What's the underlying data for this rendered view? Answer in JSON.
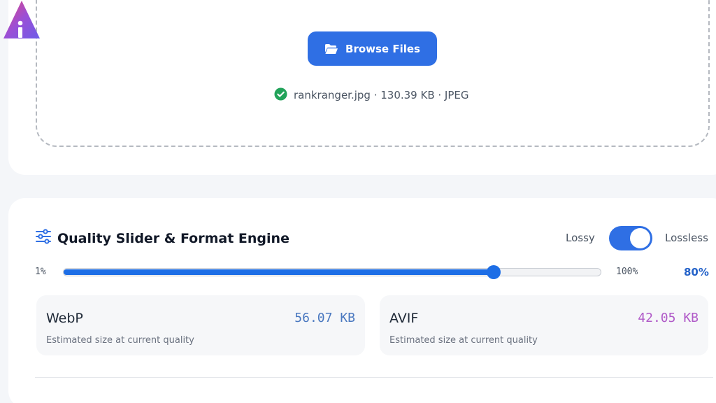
{
  "upload": {
    "browse_label": "Browse Files",
    "file_info": "rankranger.jpg · 130.39 KB · JPEG",
    "file_status": "success"
  },
  "quality": {
    "title": "Quality Slider & Format Engine",
    "mode_lossy": "Lossy",
    "mode_lossless": "Lossless",
    "mode_lossless_enabled": true,
    "range_min": "1%",
    "range_max": "100%",
    "value_label": "80%",
    "value_fraction": 0.8
  },
  "formats": [
    {
      "name": "WebP",
      "size": "56.07 KB",
      "caption": "Estimated size at current quality"
    },
    {
      "name": "AVIF",
      "size": "42.05 KB",
      "caption": "Estimated size at current quality"
    }
  ],
  "colors": {
    "accent": "#2f6fe4",
    "success": "#22a35a",
    "webp_size": "#4a78c0",
    "avif_size": "#b05ac8"
  },
  "icons": {
    "logo": "triangle-logo",
    "browse": "folder-open-icon",
    "file_status": "check-circle-icon",
    "quality": "sliders-icon"
  }
}
